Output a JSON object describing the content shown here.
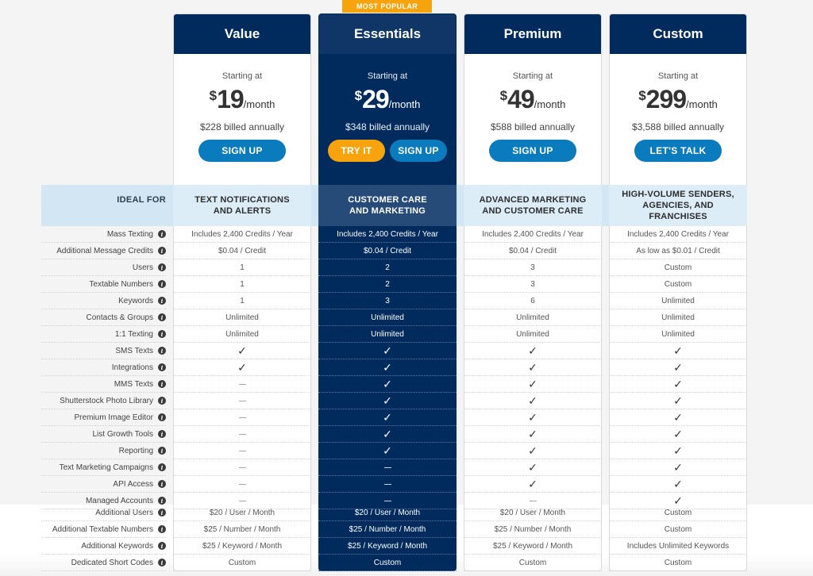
{
  "badge": "MOST POPULAR",
  "ideal_for_label": "IDEAL FOR",
  "plans": [
    {
      "name": "Value",
      "starting_label": "Starting at",
      "currency": "$",
      "price": "19",
      "period": "/month",
      "billed": "$228 billed annually",
      "buttons": [
        {
          "label": "SIGN UP",
          "style": "blue"
        }
      ],
      "ideal_for": [
        "TEXT NOTIFICATIONS",
        "AND ALERTS"
      ],
      "featured": false
    },
    {
      "name": "Essentials",
      "starting_label": "Starting at",
      "currency": "$",
      "price": "29",
      "period": "/month",
      "billed": "$348 billed annually",
      "buttons": [
        {
          "label": "TRY IT",
          "style": "orange"
        },
        {
          "label": "SIGN UP",
          "style": "blue"
        }
      ],
      "ideal_for": [
        "CUSTOMER CARE",
        "AND MARKETING"
      ],
      "featured": true
    },
    {
      "name": "Premium",
      "starting_label": "Starting at",
      "currency": "$",
      "price": "49",
      "period": "/month",
      "billed": "$588 billed annually",
      "buttons": [
        {
          "label": "SIGN UP",
          "style": "blue"
        }
      ],
      "ideal_for": [
        "ADVANCED MARKETING",
        "AND CUSTOMER CARE"
      ],
      "featured": false
    },
    {
      "name": "Custom",
      "starting_label": "Starting at",
      "currency": "$",
      "price": "299",
      "period": "/month",
      "billed": "$3,588 billed annually",
      "buttons": [
        {
          "label": "LET'S TALK",
          "style": "blue"
        }
      ],
      "ideal_for": [
        "HIGH-VOLUME SENDERS,",
        "AGENCIES, AND FRANCHISES"
      ],
      "featured": false
    }
  ],
  "features": [
    {
      "label": "Mass Texting",
      "values": [
        "Includes 2,400 Credits / Year",
        "Includes 2,400 Credits / Year",
        "Includes 2,400 Credits / Year",
        "Includes 2,400 Credits / Year"
      ]
    },
    {
      "label": "Additional Message Credits",
      "values": [
        "$0.04 / Credit",
        "$0.04 / Credit",
        "$0.04 / Credit",
        "As low as $0.01 / Credit"
      ]
    },
    {
      "label": "Users",
      "values": [
        "1",
        "2",
        "3",
        "Custom"
      ]
    },
    {
      "label": "Textable Numbers",
      "values": [
        "1",
        "2",
        "3",
        "Custom"
      ]
    },
    {
      "label": "Keywords",
      "values": [
        "1",
        "3",
        "6",
        "Unlimited"
      ]
    },
    {
      "label": "Contacts & Groups",
      "values": [
        "Unlimited",
        "Unlimited",
        "Unlimited",
        "Unlimited"
      ]
    },
    {
      "label": "1:1 Texting",
      "values": [
        "Unlimited",
        "Unlimited",
        "Unlimited",
        "Unlimited"
      ]
    },
    {
      "label": "SMS Texts",
      "values": [
        "check",
        "check",
        "check",
        "check"
      ]
    },
    {
      "label": "Integrations",
      "values": [
        "check",
        "check",
        "check",
        "check"
      ]
    },
    {
      "label": "MMS Texts",
      "values": [
        "dash",
        "check",
        "check",
        "check"
      ]
    },
    {
      "label": "Shutterstock Photo Library",
      "values": [
        "dash",
        "check",
        "check",
        "check"
      ]
    },
    {
      "label": "Premium Image Editor",
      "values": [
        "dash",
        "check",
        "check",
        "check"
      ]
    },
    {
      "label": "List Growth Tools",
      "values": [
        "dash",
        "check",
        "check",
        "check"
      ]
    },
    {
      "label": "Reporting",
      "values": [
        "dash",
        "check",
        "check",
        "check"
      ]
    },
    {
      "label": "Text Marketing Campaigns",
      "values": [
        "dash",
        "dash",
        "check",
        "check"
      ]
    },
    {
      "label": "API Access",
      "values": [
        "dash",
        "dash",
        "check",
        "check"
      ]
    },
    {
      "label": "Managed Accounts",
      "values": [
        "dash",
        "dash",
        "dash",
        "check"
      ]
    }
  ],
  "addons": [
    {
      "label": "Additional Users",
      "values": [
        "$20 / User / Month",
        "$20 / User / Month",
        "$20 / User / Month",
        "Custom"
      ]
    },
    {
      "label": "Additional Textable Numbers",
      "values": [
        "$25 / Number / Month",
        "$25 / Number / Month",
        "$25 / Number / Month",
        "Custom"
      ]
    },
    {
      "label": "Additional Keywords",
      "values": [
        "$25 / Keyword / Month",
        "$25 / Keyword / Month",
        "$25 / Keyword / Month",
        "Includes Unlimited Keywords"
      ]
    },
    {
      "label": "Dedicated Short Codes",
      "values": [
        "Custom",
        "Custom",
        "Custom",
        "Custom"
      ]
    }
  ],
  "colors": {
    "navy": "#002b5c",
    "button_blue": "#0a7bbd",
    "accent_orange": "#f7a30e",
    "ideal_band": "#d3e6f3"
  }
}
